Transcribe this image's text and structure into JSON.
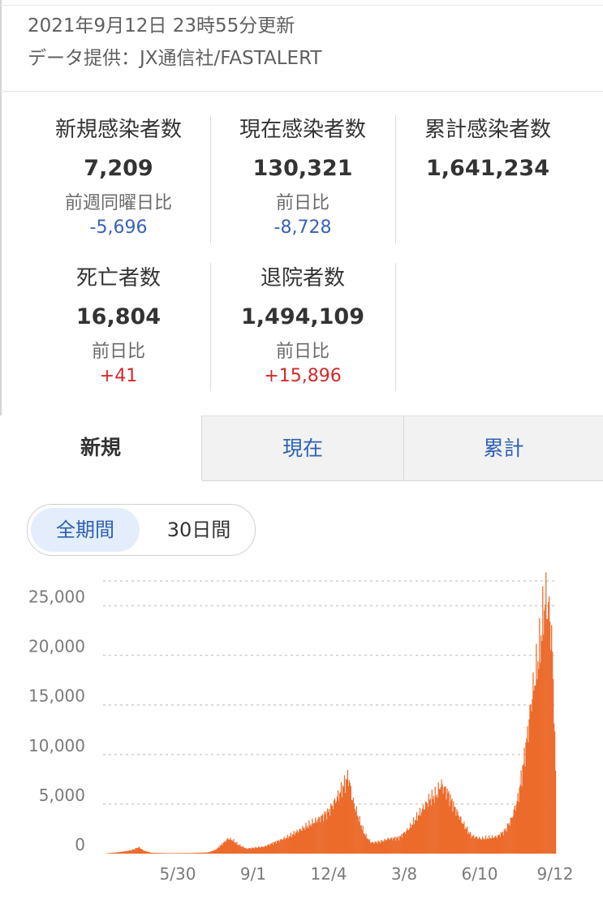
{
  "header": {
    "updated": "2021年9月12日 23時55分更新",
    "source": "データ提供：JX通信社/FASTALERT"
  },
  "stats": {
    "new": {
      "label": "新規感染者数",
      "value": "7,209",
      "compare_label": "前週同曜日比",
      "diff": "-5,696"
    },
    "current": {
      "label": "現在感染者数",
      "value": "130,321",
      "compare_label": "前日比",
      "diff": "-8,728"
    },
    "total": {
      "label": "累計感染者数",
      "value": "1,641,234"
    },
    "deaths": {
      "label": "死亡者数",
      "value": "16,804",
      "compare_label": "前日比",
      "diff": "+41"
    },
    "discharged": {
      "label": "退院者数",
      "value": "1,494,109",
      "compare_label": "前日比",
      "diff": "+15,896"
    }
  },
  "tabs": [
    {
      "label": "新規",
      "active": true
    },
    {
      "label": "現在",
      "active": false
    },
    {
      "label": "累計",
      "active": false
    }
  ],
  "period_toggle": {
    "options": [
      "全期間",
      "30日間"
    ],
    "selected": "全期間"
  },
  "colors": {
    "bar": "#ec6a2a",
    "link_blue": "#2f61b3",
    "decrease": "#3a62b5",
    "increase": "#d32a2a",
    "toggle_active_bg": "#e4edfb"
  },
  "chart_data": {
    "type": "bar",
    "ylim": [
      0,
      27500
    ],
    "yticks": [
      0,
      5000,
      10000,
      15000,
      20000,
      25000
    ],
    "ytick_labels": [
      "0",
      "5,000",
      "10,000",
      "15,000",
      "20,000",
      "25,000"
    ],
    "xtick_labels": [
      "5/30",
      "9/1",
      "12/4",
      "3/8",
      "6/10",
      "9/12"
    ],
    "xtick_day_index": [
      93,
      187,
      281,
      375,
      469,
      563
    ],
    "grid": true,
    "legend": "none",
    "day_count": 564,
    "trend": [
      [
        0,
        0
      ],
      [
        20,
        150
      ],
      [
        35,
        350
      ],
      [
        44,
        650
      ],
      [
        50,
        300
      ],
      [
        60,
        80
      ],
      [
        80,
        50
      ],
      [
        110,
        60
      ],
      [
        130,
        120
      ],
      [
        140,
        400
      ],
      [
        155,
        1500
      ],
      [
        160,
        1400
      ],
      [
        168,
        900
      ],
      [
        178,
        500
      ],
      [
        200,
        700
      ],
      [
        215,
        1200
      ],
      [
        230,
        1700
      ],
      [
        245,
        2400
      ],
      [
        258,
        3000
      ],
      [
        270,
        3600
      ],
      [
        280,
        4200
      ],
      [
        290,
        5500
      ],
      [
        300,
        7000
      ],
      [
        305,
        7800
      ],
      [
        310,
        5500
      ],
      [
        318,
        3500
      ],
      [
        325,
        2000
      ],
      [
        333,
        1100
      ],
      [
        345,
        1200
      ],
      [
        355,
        1500
      ],
      [
        368,
        1600
      ],
      [
        380,
        2500
      ],
      [
        395,
        4200
      ],
      [
        405,
        5400
      ],
      [
        415,
        6000
      ],
      [
        420,
        7000
      ],
      [
        428,
        6200
      ],
      [
        438,
        4500
      ],
      [
        448,
        3000
      ],
      [
        458,
        1800
      ],
      [
        470,
        1500
      ],
      [
        490,
        1700
      ],
      [
        500,
        2300
      ],
      [
        508,
        3500
      ],
      [
        516,
        5500
      ],
      [
        522,
        8500
      ],
      [
        528,
        12000
      ],
      [
        533,
        15500
      ],
      [
        538,
        18000
      ],
      [
        543,
        20500
      ],
      [
        547,
        23500
      ],
      [
        550,
        25700
      ],
      [
        553,
        25000
      ],
      [
        556,
        24000
      ],
      [
        559,
        20000
      ],
      [
        561,
        15000
      ],
      [
        562,
        11000
      ],
      [
        563,
        8500
      ]
    ]
  }
}
